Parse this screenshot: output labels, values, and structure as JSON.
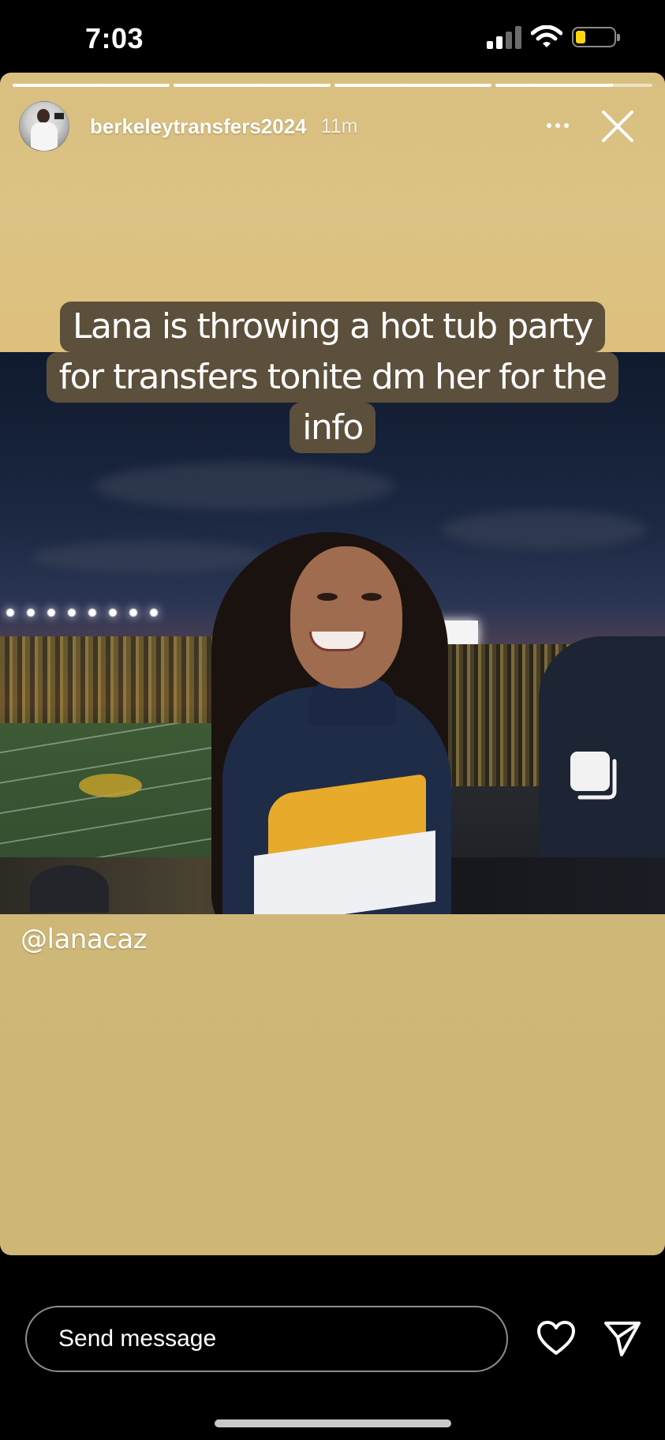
{
  "status_bar": {
    "time": "7:03",
    "signal_bars_filled": 2,
    "signal_bars_total": 4,
    "battery_level": 0.25,
    "battery_color": "#ffd60a",
    "icons": [
      "cellular-signal-icon",
      "wifi-icon",
      "battery-icon"
    ]
  },
  "story": {
    "background_color": "#d9c07f",
    "progress": [
      1,
      1,
      1,
      0.75
    ],
    "account": {
      "username": "berkeleytransfers2024",
      "time_ago": "11m"
    },
    "caption_lines": [
      "Lana is throwing a hot tub party",
      "for transfers tonite dm her for the",
      "info"
    ],
    "caption_background": "#5c4f3b",
    "mention": "@lanacaz",
    "icons": [
      "more-options-icon",
      "close-icon",
      "multiple-photos-icon"
    ]
  },
  "reply_bar": {
    "placeholder": "Send message",
    "icons": [
      "heart-icon",
      "send-icon"
    ]
  }
}
